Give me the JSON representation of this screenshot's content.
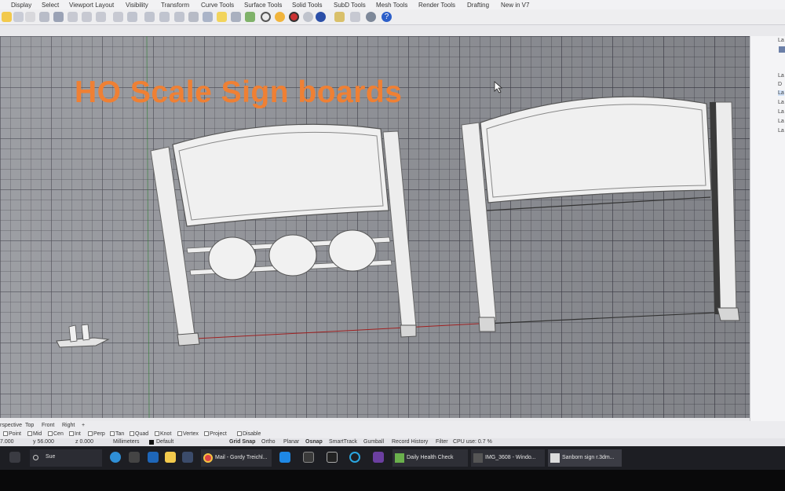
{
  "menu": [
    "Display",
    "Select",
    "Viewport Layout",
    "Visibility",
    "Transform",
    "Curve Tools",
    "Surface Tools",
    "Solid Tools",
    "SubD Tools",
    "Mesh Tools",
    "Render Tools",
    "Drafting",
    "New in V7"
  ],
  "viewport": {
    "title": "HO Scale Sign boards"
  },
  "layers_panel": {
    "items": [
      "La",
      "La",
      "D",
      "La",
      "La",
      "La",
      "La",
      "La"
    ]
  },
  "viewport_tabs": [
    "rspective",
    "Top",
    "Front",
    "Right",
    "+"
  ],
  "osnap": [
    "Point",
    "Mid",
    "Cen",
    "Int",
    "Perp",
    "Tan",
    "Quad",
    "Knot",
    "Vertex",
    "Project",
    "Disable"
  ],
  "status": {
    "x": "7.000",
    "y": "y 56.000",
    "z": "z 0.000",
    "units": "Millimeters",
    "layer": "Default",
    "toggles": [
      "Grid Snap",
      "Ortho",
      "Planar",
      "Osnap",
      "SmartTrack",
      "Gumball",
      "Record History",
      "Filter"
    ],
    "cpu": "CPU use: 0.7 %"
  },
  "taskbar": {
    "search_text": "Sue",
    "items": [
      "Mail - Gordy Treichl...",
      "Daily Health Check",
      "IMG_3608 - Windo...",
      "Sanborn sign r.3dm..."
    ]
  },
  "colors": {
    "title_orange": "#ef8034",
    "viewport_gray": "#8f9197",
    "sign_white": "#ececec",
    "taskbar_dark": "#1d1e23"
  }
}
